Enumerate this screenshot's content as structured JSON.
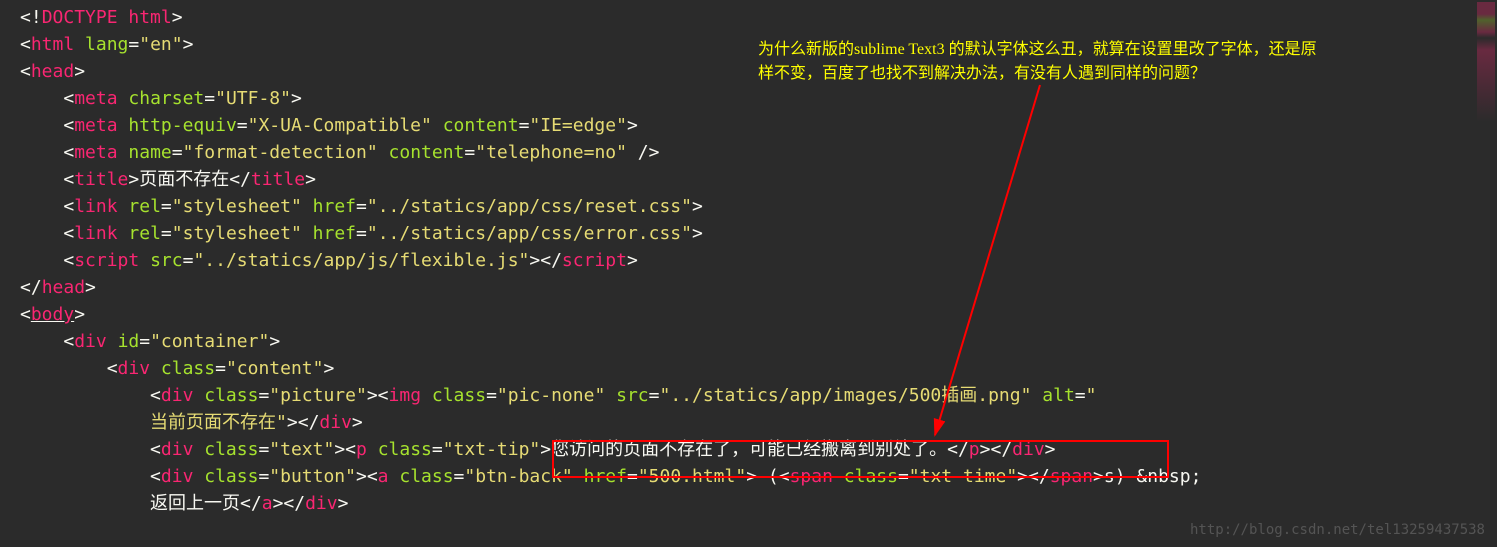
{
  "code": {
    "line1_doctype": "DOCTYPE html",
    "line2_tag": "html",
    "line2_attr": "lang",
    "line2_val": "\"en\"",
    "line3_tag": "head",
    "line4_tag": "meta",
    "line4_attr": "charset",
    "line4_val": "\"UTF-8\"",
    "line5_tag": "meta",
    "line5_attr1": "http-equiv",
    "line5_val1": "\"X-UA-Compatible\"",
    "line5_attr2": "content",
    "line5_val2": "\"IE=edge\"",
    "line6_tag": "meta",
    "line6_attr1": "name",
    "line6_val1": "\"format-detection\"",
    "line6_attr2": "content",
    "line6_val2": "\"telephone=no\"",
    "line7_tag": "title",
    "line7_text": "页面不存在",
    "line8_tag": "link",
    "line8_attr1": "rel",
    "line8_val1": "\"stylesheet\"",
    "line8_attr2": "href",
    "line8_val2": "\"../statics/app/css/reset.css\"",
    "line9_tag": "link",
    "line9_attr1": "rel",
    "line9_val1": "\"stylesheet\"",
    "line9_attr2": "href",
    "line9_val2": "\"../statics/app/css/error.css\"",
    "line10_tag": "script",
    "line10_attr": "src",
    "line10_val": "\"../statics/app/js/flexible.js\"",
    "line11_tag": "head",
    "line12_tag": "body",
    "line13_tag": "div",
    "line13_attr": "id",
    "line13_val": "\"container\"",
    "line14_tag": "div",
    "line14_attr": "class",
    "line14_val": "\"content\"",
    "line15_tag": "div",
    "line15_attr": "class",
    "line15_val": "\"picture\"",
    "line15_tag2": "img",
    "line15_attr2": "class",
    "line15_val2": "\"pic-none\"",
    "line15_attr3": "src",
    "line15_val3": "\"../statics/app/images/500插画.png\"",
    "line15_attr4": "alt",
    "line15_val15b": "\"",
    "line16_text": "当前页面不存在\"",
    "line17_tag": "div",
    "line17_attr": "class",
    "line17_val": "\"text\"",
    "line17_tag2": "p",
    "line17_attr2": "class",
    "line17_val2": "\"txt-tip\"",
    "line17_text": "您访问的页面不存在了，可能已经搬离到别处了。",
    "line18_tag": "div",
    "line18_attr": "class",
    "line18_val": "\"button\"",
    "line18_tag2": "a",
    "line18_attr2": "class",
    "line18_val2": "\"btn-back\"",
    "line18_attr3": "href",
    "line18_val3": "\"500.html\"",
    "line18_text2": " (",
    "line18_tag3": "span",
    "line18_attr4": "class",
    "line18_val4": "\"txt-time\"",
    "line18_text3": "s) &nbsp;",
    "line19_text": "返回上一页"
  },
  "annotation": {
    "line1": "为什么新版的sublime Text3 的默认字体这么丑，就算在设置里改了字体，还是原",
    "line2": "样不变，百度了也找不到解决办法，有没有人遇到同样的问题？"
  },
  "watermark": "http://blog.csdn.net/tel13259437538"
}
